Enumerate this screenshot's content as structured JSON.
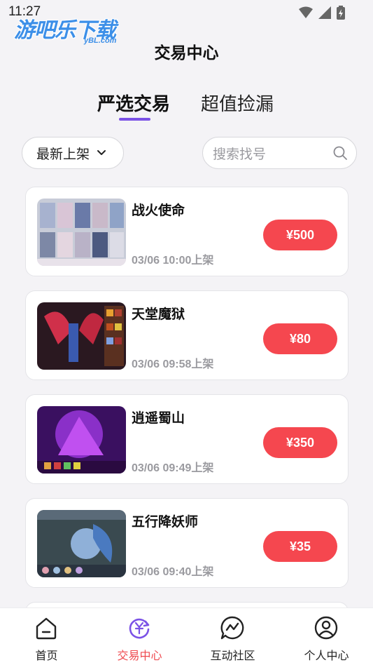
{
  "status": {
    "time": "11:27"
  },
  "watermark": {
    "main": "游吧乐下载",
    "sub": "yBL.com"
  },
  "header": {
    "title": "交易中心"
  },
  "tabs": [
    {
      "label": "严选交易",
      "active": true
    },
    {
      "label": "超值捡漏",
      "active": false
    }
  ],
  "filter": {
    "sort_label": "最新上架",
    "search_placeholder": "搜索找号"
  },
  "listings": [
    {
      "title": "战火使命",
      "time": "03/06 10:00上架",
      "price": "¥500"
    },
    {
      "title": "天堂魔狱",
      "time": "03/06 09:58上架",
      "price": "¥80"
    },
    {
      "title": "逍遥蜀山",
      "time": "03/06 09:49上架",
      "price": "¥350"
    },
    {
      "title": "五行降妖师",
      "time": "03/06 09:40上架",
      "price": "¥35"
    }
  ],
  "bottom_nav": [
    {
      "label": "首页",
      "icon": "home-icon",
      "active": false
    },
    {
      "label": "交易中心",
      "icon": "trade-exchange-icon",
      "active": true
    },
    {
      "label": "互动社区",
      "icon": "community-chat-icon",
      "active": false
    },
    {
      "label": "个人中心",
      "icon": "user-profile-icon",
      "active": false
    }
  ],
  "colors": {
    "accent": "#f5474f",
    "tab_indicator": "#7b52e6",
    "active_nav": "#ef4a4f"
  }
}
